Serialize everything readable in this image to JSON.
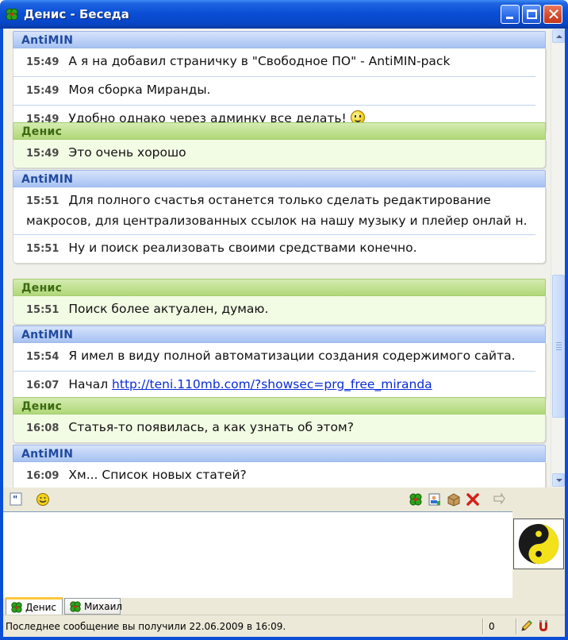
{
  "window": {
    "title": "Денис - Беседа"
  },
  "log": {
    "groups": [
      {
        "sender": "AntiMIN",
        "kind": "blue",
        "messages": [
          {
            "time": "15:49",
            "text": "А я на добавил страничку в \"Свободное ПО\" - AntiMIN-pack"
          },
          {
            "time": "15:49",
            "text": "Моя сборка Миранды."
          },
          {
            "time": "15:49",
            "text": "Удобно однако через админку все делать! "
          }
        ]
      },
      {
        "sender": "Денис",
        "kind": "green",
        "messages": [
          {
            "time": "15:49",
            "text": "Это очень хорошо"
          }
        ]
      },
      {
        "sender": "AntiMIN",
        "kind": "blue",
        "messages": [
          {
            "time": "15:51",
            "text": "Для полного счастья останется только сделать редактирование макросов, для централизованных ссылок на нашу музыку и плейер онлай н."
          },
          {
            "time": "15:51",
            "text": "Ну и поиск реализовать своими средствами конечно."
          }
        ]
      },
      {
        "sender": "Денис",
        "kind": "green",
        "messages": [
          {
            "time": "15:51",
            "text": "Поиск более актуален, думаю."
          }
        ]
      },
      {
        "sender": "AntiMIN",
        "kind": "blue",
        "messages": [
          {
            "time": "15:54",
            "text": "Я имел в виду полной автоматизации создания содержимого сайта."
          },
          {
            "time": "16:07",
            "prefix": "Начал ",
            "link": "http://teni.110mb.com/?showsec=prg_free_miranda"
          }
        ]
      },
      {
        "sender": "Денис",
        "kind": "green",
        "messages": [
          {
            "time": "16:08",
            "text": "Статья-то появилась, а как узнать об этом?"
          }
        ]
      },
      {
        "sender": "AntiMIN",
        "kind": "blue",
        "messages": [
          {
            "time": "16:09",
            "text": "Хм... Список новых статей?"
          }
        ]
      }
    ]
  },
  "tabs": [
    {
      "label": "Денис",
      "active": true
    },
    {
      "label": "Михаил",
      "active": false
    }
  ],
  "status": {
    "text": "Последнее сообщение вы получили 22.06.2009 в 16:09.",
    "count": "0"
  },
  "input": {
    "value": ""
  },
  "icons": {
    "app": "clover-icon",
    "toolbar_left": [
      "quote-icon",
      "smiley-icon"
    ],
    "toolbar_right": [
      "clover-icon",
      "user-info-icon",
      "history-icon",
      "close-x-icon",
      "send-arrow-icon"
    ],
    "status": [
      "pencil-icon",
      "encryption-icon"
    ]
  }
}
